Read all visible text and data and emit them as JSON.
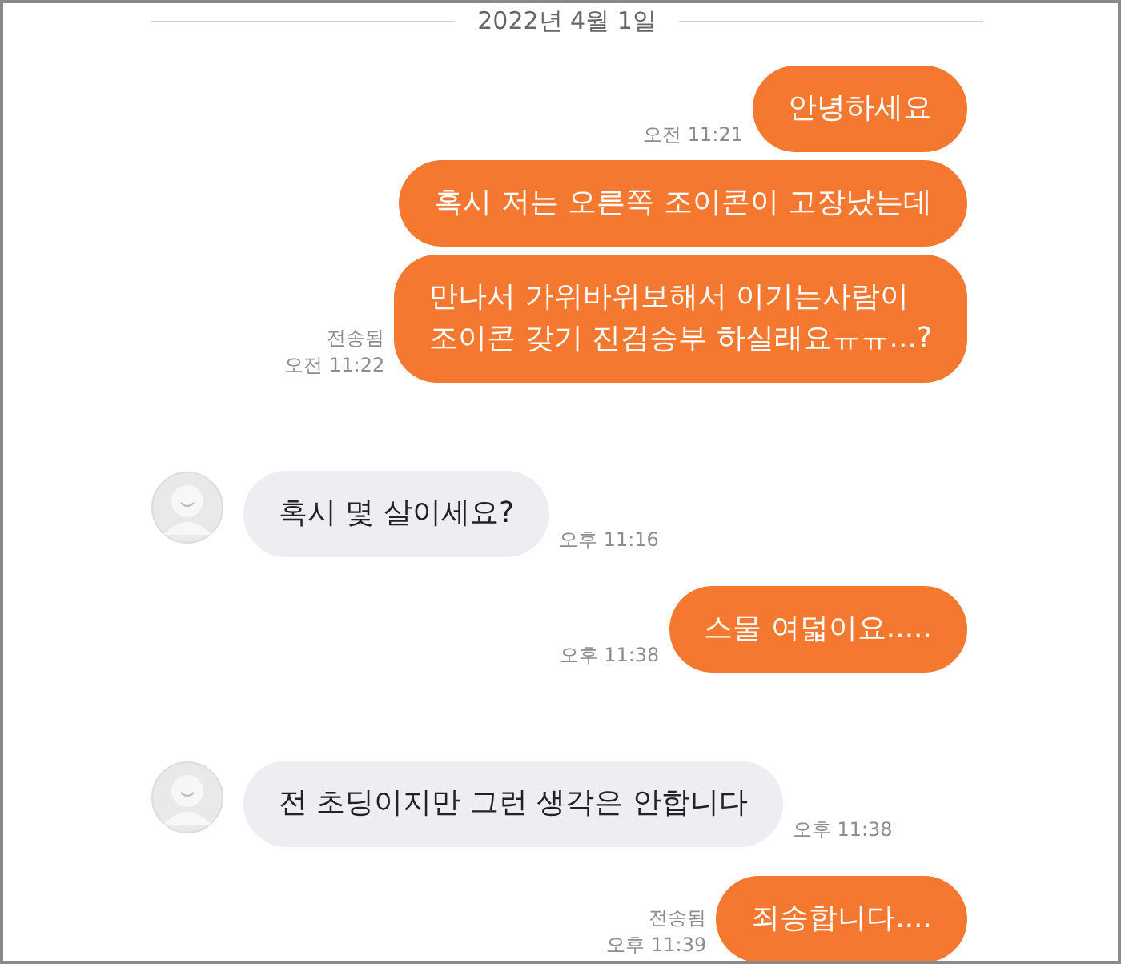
{
  "date_divider": "2022년 4월 1일",
  "messages": [
    {
      "kind": "sent",
      "text": "안녕하세요",
      "time": "오전 11:21"
    },
    {
      "kind": "sent",
      "text": "혹시 저는 오른쪽 조이콘이 고장났는데"
    },
    {
      "kind": "sent",
      "text": "만나서 가위바위보해서 이기는사람이\n조이콘 갖기 진검승부 하실래요ㅠㅠ...?",
      "status": "전송됨",
      "time": "오전 11:22"
    },
    {
      "kind": "received",
      "text": "혹시 몇 살이세요?",
      "time": "오후 11:16"
    },
    {
      "kind": "sent",
      "text": "스물 여덟이요.....",
      "time": "오후 11:38"
    },
    {
      "kind": "received",
      "text": "전 초딩이지만 그런 생각은 안합니다",
      "time": "오후 11:38"
    },
    {
      "kind": "sent",
      "text": "죄송합니다....",
      "status": "전송됨",
      "time": "오후 11:39"
    }
  ]
}
